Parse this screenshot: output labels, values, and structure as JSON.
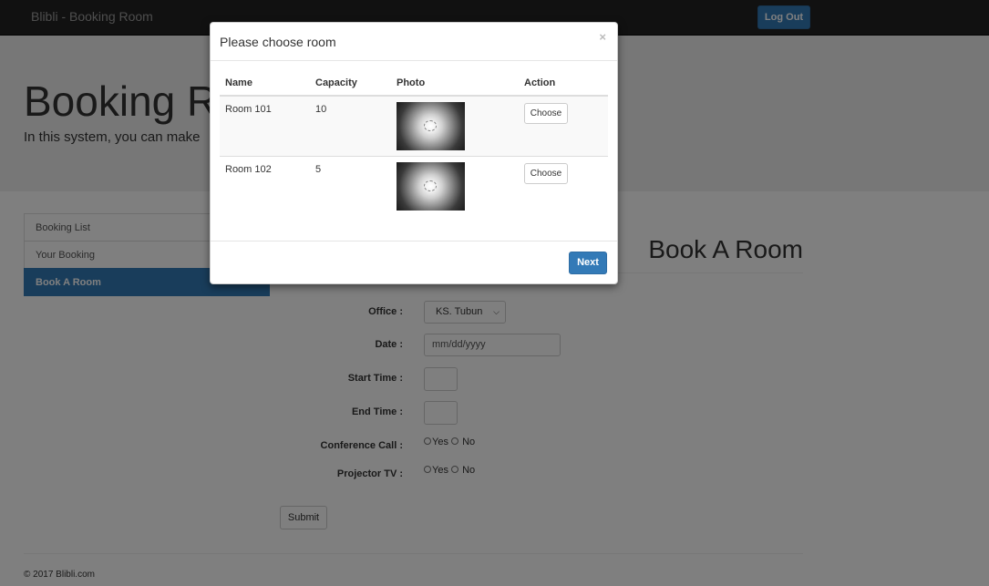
{
  "navbar": {
    "brand": "Blibli - Booking Room",
    "logout_label": "Log Out"
  },
  "jumbotron": {
    "title": "Booking Room",
    "subtitle": "In this system, you can make"
  },
  "sidebar": {
    "items": [
      {
        "label": "Booking List"
      },
      {
        "label": "Your Booking"
      },
      {
        "label": "Book A Room",
        "active": true
      }
    ]
  },
  "form": {
    "title": "Book A Room",
    "office_label": "Office :",
    "office_value": "KS. Tubun",
    "date_label": "Date :",
    "date_placeholder": "mm/dd/yyyy",
    "start_label": "Start Time :",
    "end_label": "End Time :",
    "conference_label": "Conference Call :",
    "projector_label": "Projector TV :",
    "yes_label": "Yes",
    "no_label": "No",
    "submit_label": "Submit"
  },
  "footer": {
    "text": "© 2017 Blibli.com"
  },
  "modal": {
    "title": "Please choose room",
    "close_glyph": "×",
    "columns": [
      "Name",
      "Capacity",
      "Photo",
      "Action"
    ],
    "rows": [
      {
        "name": "Room 101",
        "capacity": "10",
        "action": "Choose"
      },
      {
        "name": "Room 102",
        "capacity": "5",
        "action": "Choose"
      }
    ],
    "next_label": "Next"
  },
  "colors": {
    "primary": "#337ab7",
    "navbar": "#222222",
    "jumbotron": "#eeeeee"
  }
}
